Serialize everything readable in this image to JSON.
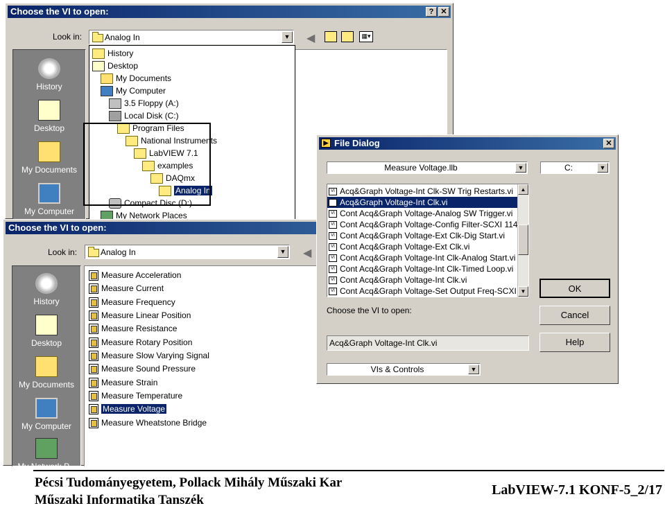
{
  "dialog_back": {
    "title": "Choose the VI to open:",
    "look_in_label": "Look in:",
    "look_in_value": "Analog In",
    "places": [
      "History",
      "Desktop",
      "My Documents",
      "My Computer"
    ],
    "dropdown_items": [
      {
        "label": "History",
        "level": 0
      },
      {
        "label": "Desktop",
        "level": 0
      },
      {
        "label": "My Documents",
        "level": 1
      },
      {
        "label": "My Computer",
        "level": 1
      },
      {
        "label": "3.5 Floppy (A:)",
        "level": 2
      },
      {
        "label": "Local Disk (C:)",
        "level": 2
      },
      {
        "label": "Program Files",
        "level": 3
      },
      {
        "label": "National Instruments",
        "level": 4
      },
      {
        "label": "LabVIEW 7.1",
        "level": 5
      },
      {
        "label": "examples",
        "level": 6
      },
      {
        "label": "DAQmx",
        "level": 7
      },
      {
        "label": "Analog In",
        "level": 8
      },
      {
        "label": "Compact Disc (D:)",
        "level": 2
      },
      {
        "label": "My Network Places",
        "level": 1
      }
    ]
  },
  "dialog_front": {
    "title": "Choose the VI to open:",
    "look_in_label": "Look in:",
    "look_in_value": "Analog In",
    "places": [
      "History",
      "Desktop",
      "My Documents",
      "My Computer",
      "My Network P..."
    ],
    "files": [
      "Measure Acceleration",
      "Measure Current",
      "Measure Frequency",
      "Measure Linear Position",
      "Measure Resistance",
      "Measure Rotary Position",
      "Measure Slow Varying Signal",
      "Measure Sound Pressure",
      "Measure Strain",
      "Measure Temperature",
      "Measure Voltage",
      "Measure Wheatstone Bridge"
    ],
    "selected_file": "Measure Voltage"
  },
  "file_dialog": {
    "title": "File Dialog",
    "library": "Measure Voltage.llb",
    "drive": "C:",
    "vis": [
      "Acq&Graph Voltage-Int Clk-SW Trig Restarts.vi",
      "Acq&Graph Voltage-Int Clk.vi",
      "Cont Acq&Graph Voltage-Analog SW Trigger.vi",
      "Cont Acq&Graph Voltage-Config Filter-SCXI 114",
      "Cont Acq&Graph Voltage-Ext Clk-Dig Start.vi",
      "Cont Acq&Graph Voltage-Ext Clk.vi",
      "Cont Acq&Graph Voltage-Int Clk-Analog Start.vi",
      "Cont Acq&Graph Voltage-Int Clk-Timed Loop.vi",
      "Cont Acq&Graph Voltage-Int Clk.vi",
      "Cont Acq&Graph Voltage-Set Output Freq-SCXI"
    ],
    "selected_vi": "Acq&Graph Voltage-Int Clk.vi",
    "choose_label": "Choose the VI to open:",
    "filename_value": "Acq&Graph Voltage-Int Clk.vi",
    "filter": "VIs & Controls",
    "ok_label": "OK",
    "cancel_label": "Cancel",
    "help_label": "Help"
  },
  "footer": {
    "line1": "Pécsi Tudományegyetem, Pollack Mihály Műszaki Kar",
    "line2": "Műszaki Informatika Tanszék",
    "page": "LabVIEW-7.1 KONF-5_2/17"
  },
  "colors": {
    "titlebar": "#0a246a",
    "selection": "#0a246a",
    "window": "#d4d0c8",
    "places_bar": "#808080"
  }
}
